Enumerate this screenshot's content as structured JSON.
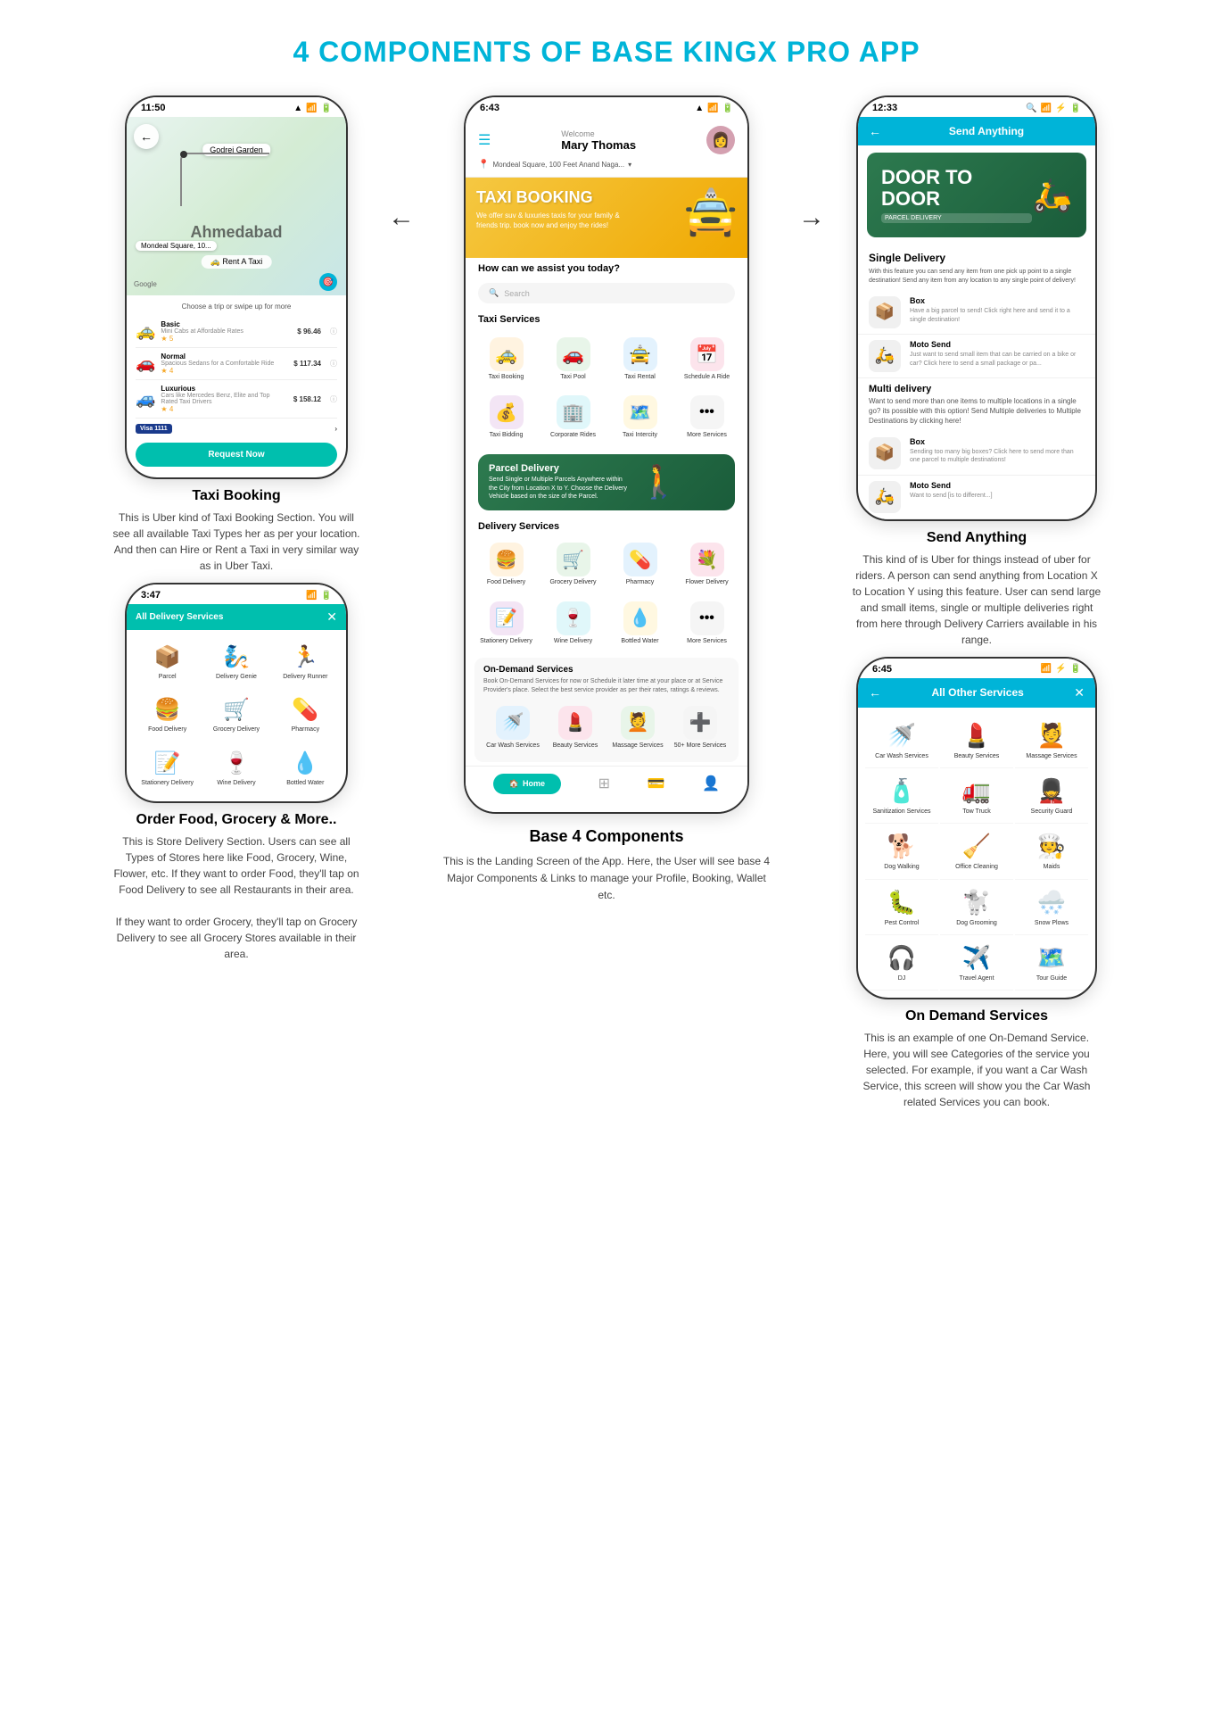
{
  "page": {
    "title": "4 COMPONENTS OF BASE KINGX PRO APP"
  },
  "taxi_phone": {
    "time": "11:50",
    "map_label": "Godrej Garden",
    "city": "Ahmedabad",
    "rent": "🚕 Rent A Taxi",
    "choose_text": "Choose a trip or swipe up for more",
    "options": [
      {
        "name": "Basic",
        "desc": "Mini Cabs at Affordable Rates",
        "stars": "★ 5",
        "price": "$ 96.46"
      },
      {
        "name": "Normal",
        "desc": "Spacious Sedans for a Comfortable Ride",
        "stars": "★ 4",
        "price": "$ 117.34"
      },
      {
        "name": "Luxurious",
        "desc": "Cars like Mercedes Benz, Elite and Top Rated Taxi Drivers",
        "stars": "★ 4",
        "price": "$ 158.12"
      }
    ],
    "visa": "Visa 1111",
    "request_btn": "Request Now"
  },
  "taxi_desc": {
    "title": "Taxi Booking",
    "text": "This is Uber kind of Taxi Booking Section. You will see all available Taxi Types her as per your location. And then can Hire or Rent a Taxi in very similar way as in Uber Taxi."
  },
  "order_phone": {
    "time": "3:47",
    "header": "All Delivery Services",
    "items": [
      {
        "label": "Parcel",
        "icon": "📦"
      },
      {
        "label": "Delivery Genie",
        "icon": "🧞"
      },
      {
        "label": "Delivery Runner",
        "icon": "🏃"
      },
      {
        "label": "Food Delivery",
        "icon": "🍔"
      },
      {
        "label": "Grocery Delivery",
        "icon": "🛒"
      },
      {
        "label": "Pharmacy",
        "icon": "💊"
      },
      {
        "label": "Stationery Delivery",
        "icon": "📝"
      },
      {
        "label": "Wine Delivery",
        "icon": "🍷"
      },
      {
        "label": "Bottled Water",
        "icon": "💧"
      }
    ]
  },
  "order_desc": {
    "title": "Order Food, Grocery & More..",
    "text1": "This is Store Delivery Section. Users can see all Types of Stores here like Food, Grocery, Wine, Flower, etc. If they want to order Food, they'll tap on Food Delivery to see all Restaurants in their area.",
    "text2": "If they want to order Grocery, they'll tap on Grocery Delivery to see all Grocery Stores available in their area."
  },
  "main_phone": {
    "time": "6:43",
    "welcome": "Welcome",
    "user": "Mary Thomas",
    "location": "Mondeal Square, 100 Feet Anand Naga...",
    "banner": {
      "title": "TAXI BOOKING",
      "desc": "We offer suv & luxuries taxis for your family & friends trip. book now and enjoy the rides!"
    },
    "assist": "How can we assist you today?",
    "search_placeholder": "Search",
    "taxi_services_title": "Taxi Services",
    "taxi_services": [
      {
        "label": "Taxi Booking",
        "icon": "🚕",
        "color": "#fff3e0"
      },
      {
        "label": "Taxi Pool",
        "icon": "🚗",
        "color": "#e8f5e9"
      },
      {
        "label": "Taxi Rental",
        "icon": "🚖",
        "color": "#e3f2fd"
      },
      {
        "label": "Schedule A Ride",
        "icon": "📅",
        "color": "#fce4ec"
      },
      {
        "label": "Taxi Bidding",
        "icon": "💰",
        "color": "#f3e5f5"
      },
      {
        "label": "Corporate Rides",
        "icon": "🏢",
        "color": "#e0f7fa"
      },
      {
        "label": "Taxi Intercity",
        "icon": "🗺️",
        "color": "#fff8e1"
      },
      {
        "label": "More Services",
        "icon": "⋯",
        "color": "#f5f5f5"
      }
    ],
    "parcel_banner": {
      "title": "Parcel Delivery",
      "desc": "Send Single or Multiple Parcels Anywhere within the City from Location X to Y. Choose the Delivery Vehicle based on the size of the Parcel."
    },
    "delivery_title": "Delivery Services",
    "delivery_services": [
      {
        "label": "Food Delivery",
        "icon": "🍔",
        "color": "#fff3e0"
      },
      {
        "label": "Grocery Delivery",
        "icon": "🛒",
        "color": "#e8f5e9"
      },
      {
        "label": "Pharmacy",
        "icon": "💊",
        "color": "#e3f2fd"
      },
      {
        "label": "Flower Delivery",
        "icon": "💐",
        "color": "#fce4ec"
      },
      {
        "label": "Stationery Delivery",
        "icon": "📝",
        "color": "#f3e5f5"
      },
      {
        "label": "Wine Delivery",
        "icon": "🍷",
        "color": "#e0f7fa"
      },
      {
        "label": "Bottled Water",
        "icon": "💧",
        "color": "#fff8e1"
      },
      {
        "label": "More Services",
        "icon": "⋯",
        "color": "#f5f5f5"
      }
    ],
    "ondemand_title": "On-Demand Services",
    "ondemand_desc": "Book On-Demand Services for now or Schedule it later time at your place or at Service Provider's place. Select the best service provider as per their rates, ratings & reviews.",
    "ondemand_services": [
      {
        "label": "Car Wash Services",
        "icon": "🚿",
        "color": "#e3f2fd"
      },
      {
        "label": "Beauty Services",
        "icon": "💄",
        "color": "#fce4ec"
      },
      {
        "label": "Massage Services",
        "icon": "💆",
        "color": "#e8f5e9"
      },
      {
        "label": "50+ More Services",
        "icon": "➕",
        "color": "#f5f5f5"
      }
    ],
    "nav": [
      "Home",
      "Grid",
      "Wallet",
      "Profile"
    ]
  },
  "main_desc": {
    "title": "Base 4 Components",
    "text": "This is the Landing Screen of the App. Here, the User will see base 4 Major Components & Links to manage your Profile, Booking, Wallet etc."
  },
  "send_phone": {
    "time": "12:33",
    "header": "Send Anything",
    "door_title": "DOOR TO DOOR",
    "door_sub": "PARCEL DELIVERY",
    "single_title": "Single Delivery",
    "single_desc": "With this feature you can send any item from one pick up point to a single destination! Send any item from any location to any single point of delivery!",
    "options": [
      {
        "name": "Box",
        "desc": "Have a big parcel to send! Click right here and send it to a single destination!"
      },
      {
        "name": "Moto Send",
        "desc": "Just want to send small item that can be carried on a bike or car? Click here to send a small package or pa..."
      }
    ],
    "multi_title": "Multi delivery",
    "multi_desc": "Want to send more than one items to multiple locations in a single go? its possible with this option! Send Multiple deliveries to Multiple Destinations by clicking here!",
    "multi_options": [
      {
        "name": "Box",
        "desc": "Sending too many big boxes? Click here to send more than one parcel to multiple destinations!"
      },
      {
        "name": "Moto Send",
        "desc": "Want to send [is to different...]"
      }
    ]
  },
  "send_desc": {
    "title": "Send Anything",
    "text": "This kind of is Uber for things instead of uber for riders. A person can send anything from Location X to Location Y using this feature. User can send large and small items, single or multiple deliveries right from here through Delivery Carriers available in his range."
  },
  "ondemand_phone": {
    "time": "6:45",
    "header": "All Other Services",
    "items": [
      {
        "label": "Car Wash Services",
        "icon": "🚿"
      },
      {
        "label": "Beauty Services",
        "icon": "💄"
      },
      {
        "label": "Massage Services",
        "icon": "💆"
      },
      {
        "label": "Sanitization Services",
        "icon": "🧴"
      },
      {
        "label": "Tow Truck",
        "icon": "🚛"
      },
      {
        "label": "Security Guard",
        "icon": "💂"
      },
      {
        "label": "Dog Walking",
        "icon": "🐕"
      },
      {
        "label": "Office Cleaning",
        "icon": "🧹"
      },
      {
        "label": "Maids",
        "icon": "🧑‍🍳"
      },
      {
        "label": "Pest Control",
        "icon": "🐛"
      },
      {
        "label": "Dog Grooming",
        "icon": "🐩"
      },
      {
        "label": "Snow Plows",
        "icon": "🌨️"
      },
      {
        "label": "DJ",
        "icon": "🎧"
      },
      {
        "label": "Travel Agent",
        "icon": "✈️"
      },
      {
        "label": "Tour Guide",
        "icon": "🗺️"
      }
    ]
  },
  "ondemand_desc": {
    "title": "On Demand Services",
    "text": "This is an example of one On-Demand Service. Here, you will see Categories of the service you selected. For example, if you want a Car Wash Service, this screen will show you the Car Wash related Services you can book."
  }
}
